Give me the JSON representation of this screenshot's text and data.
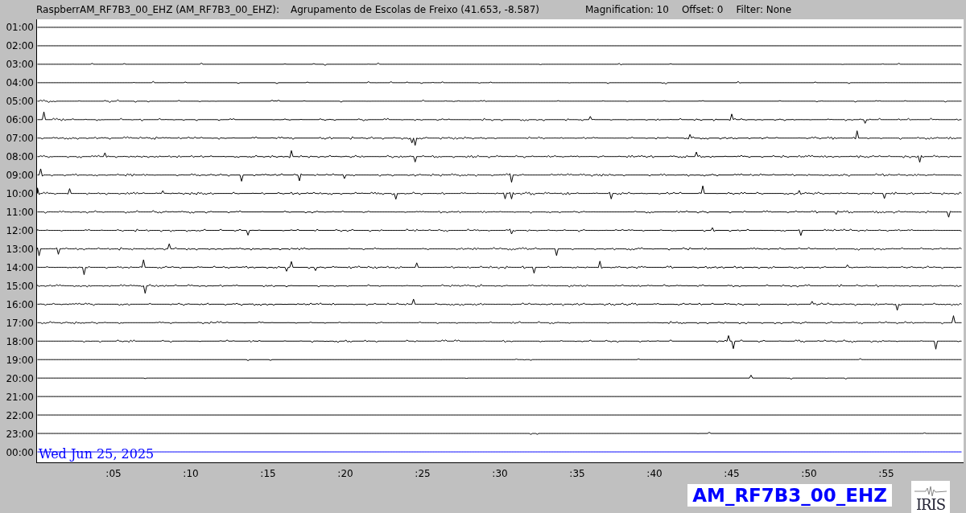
{
  "header": {
    "station": "RaspberrAM_RF7B3_00_EHZ (AM_RF7B3_00_EHZ):",
    "location": "Agrupamento de Escolas de Freixo (41.653, -8.587)",
    "magnification": "Magnification: 10",
    "offset": "Offset: 0",
    "filter": "Filter: None"
  },
  "hours": [
    "01:00",
    "02:00",
    "03:00",
    "04:00",
    "05:00",
    "06:00",
    "07:00",
    "08:00",
    "09:00",
    "10:00",
    "11:00",
    "12:00",
    "13:00",
    "14:00",
    "15:00",
    "16:00",
    "17:00",
    "18:00",
    "19:00",
    "20:00",
    "21:00",
    "22:00",
    "23:00",
    "00:00"
  ],
  "minutes": [
    ":05",
    ":10",
    ":15",
    ":20",
    ":25",
    ":30",
    ":35",
    ":40",
    ":45",
    ":50",
    ":55"
  ],
  "date": "Wed Jun 25, 2025",
  "channel_label": "AM_RF7B3_00_EHZ",
  "logo": {
    "text": "IRIS"
  }
}
